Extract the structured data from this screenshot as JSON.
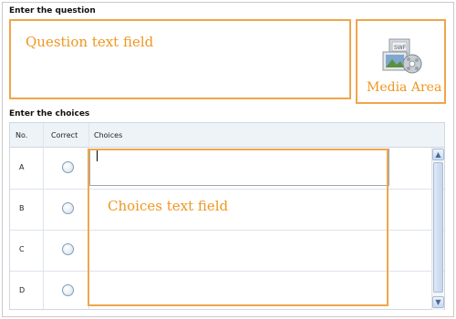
{
  "question": {
    "section_title": "Enter the question",
    "field_label": "Question text field"
  },
  "media": {
    "label": "Media Area",
    "icon": "media-files-icon"
  },
  "choices": {
    "section_title": "Enter the choices",
    "columns": [
      "No.",
      "Correct",
      "Choices"
    ],
    "rows": [
      {
        "label": "A",
        "correct": false
      },
      {
        "label": "B",
        "correct": false
      },
      {
        "label": "C",
        "correct": false
      },
      {
        "label": "D",
        "correct": false
      }
    ],
    "field_label": "Choices text field"
  },
  "colors": {
    "annotation": "#f0961e",
    "grid_header": "#eef3f8"
  }
}
